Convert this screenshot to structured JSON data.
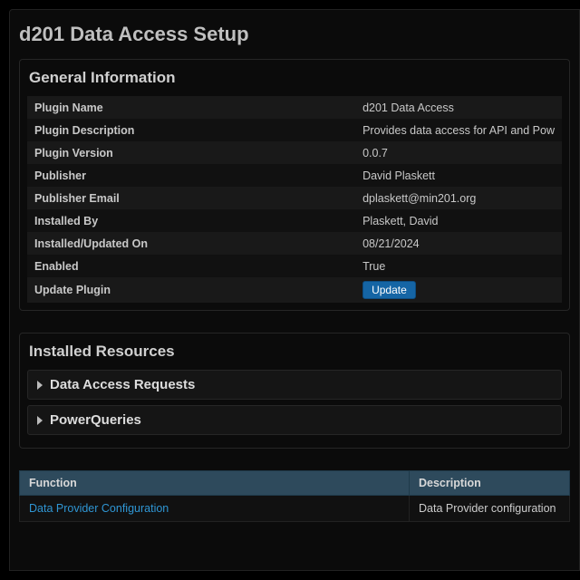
{
  "page": {
    "title": "d201 Data Access Setup"
  },
  "general": {
    "heading": "General Information",
    "rows": {
      "plugin_name": {
        "label": "Plugin Name",
        "value": "d201 Data Access"
      },
      "plugin_description": {
        "label": "Plugin Description",
        "value": "Provides data access for API and Pow"
      },
      "plugin_version": {
        "label": "Plugin Version",
        "value": "0.0.7"
      },
      "publisher": {
        "label": "Publisher",
        "value": "David Plaskett"
      },
      "publisher_email": {
        "label": "Publisher Email",
        "value": "dplaskett@min201.org"
      },
      "installed_by": {
        "label": "Installed By",
        "value": "Plaskett, David"
      },
      "installed_on": {
        "label": "Installed/Updated On",
        "value": "08/21/2024"
      },
      "enabled": {
        "label": "Enabled",
        "value": "True"
      },
      "update_plugin": {
        "label": "Update Plugin",
        "button": "Update"
      }
    }
  },
  "resources": {
    "heading": "Installed Resources",
    "accordions": [
      {
        "label": "Data Access Requests"
      },
      {
        "label": "PowerQueries"
      }
    ]
  },
  "functions": {
    "headers": {
      "function": "Function",
      "description": "Description"
    },
    "rows": [
      {
        "link": "Data Provider Configuration",
        "description": "Data Provider configuration"
      }
    ]
  }
}
